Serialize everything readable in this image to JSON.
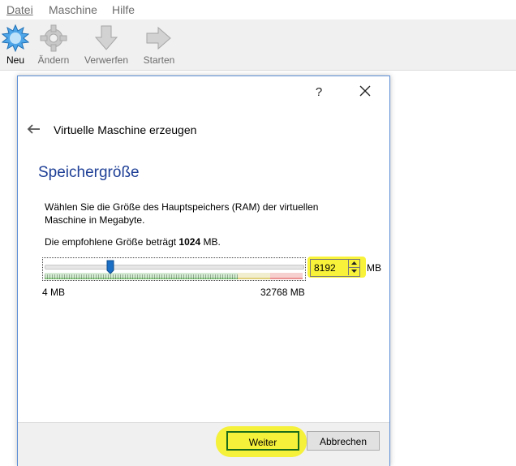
{
  "menu": {
    "items": [
      {
        "label": "Datei"
      },
      {
        "label": "Maschine"
      },
      {
        "label": "Hilfe"
      }
    ]
  },
  "toolbar": {
    "new_label": "Neu",
    "change_label": "Ändern",
    "discard_label": "Verwerfen",
    "start_label": "Starten"
  },
  "dialog": {
    "help": "?",
    "wizard_title": "Virtuelle Maschine erzeugen",
    "heading": "Speichergröße",
    "description": "Wählen Sie die Größe des Hauptspeichers (RAM) der virtuellen Maschine in Megabyte.",
    "recommend_prefix": "Die empfohlene Größe beträgt ",
    "recommend_value": "1024",
    "recommend_suffix": " MB.",
    "slider": {
      "min_label": "4 MB",
      "max_label": "32768 MB",
      "min": 4,
      "max": 32768,
      "value": 8192
    },
    "spinbox_value": "8192",
    "unit": "MB",
    "buttons": {
      "next": "Weiter",
      "cancel": "Abbrechen"
    }
  },
  "colors": {
    "heading": "#1e3f96",
    "highlight": "#f5f13a",
    "dialog_border": "#5b8ed6"
  },
  "icons": {
    "new": "starburst-icon",
    "change": "gear-icon",
    "discard": "arrow-down-icon",
    "start": "arrow-right-icon"
  }
}
